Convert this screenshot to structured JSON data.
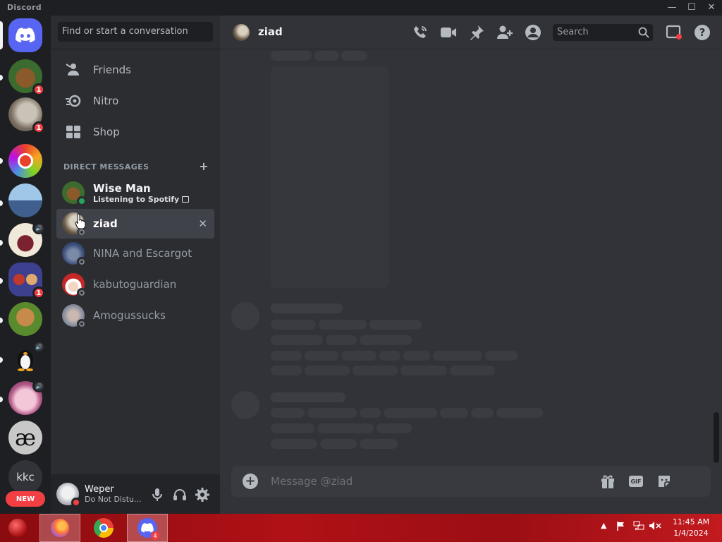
{
  "window": {
    "title": "Discord",
    "minimize": "—",
    "maximize": "☐",
    "close": "✕"
  },
  "rail": {
    "new_label": "NEW",
    "text_server": "kkc",
    "ae_server": "æ",
    "badges": [
      "1",
      "1",
      "1"
    ]
  },
  "sidebar": {
    "search_placeholder": "Find or start a conversation",
    "nav": [
      {
        "label": "Friends",
        "icon": "friends-icon"
      },
      {
        "label": "Nitro",
        "icon": "nitro-icon"
      },
      {
        "label": "Shop",
        "icon": "shop-icon"
      }
    ],
    "dm_header": "DIRECT MESSAGES",
    "dm_add": "+",
    "dms": [
      {
        "name": "Wise Man",
        "sub": "Listening to Spotify",
        "status": "online"
      },
      {
        "name": "ziad",
        "status": "offline",
        "active": true
      },
      {
        "name": "NINA and Escargot",
        "status": "offline"
      },
      {
        "name": "kabutoguardian",
        "status": "offline"
      },
      {
        "name": "Amogussucks",
        "status": "offline"
      }
    ],
    "close_glyph": "✕"
  },
  "user": {
    "name": "Weper",
    "status": "Do Not Distu..."
  },
  "channel": {
    "name": "ziad",
    "search_placeholder": "Search",
    "composer_placeholder": "Message @ziad",
    "gif_label": "GIF"
  },
  "taskbar": {
    "time": "11:45 AM",
    "date": "1/4/2024",
    "discord_badge": "4"
  },
  "colors": {
    "blurple": "#5865f2",
    "online": "#23a55a",
    "dnd": "#f23f43",
    "bg_main": "#313338",
    "bg_sidebar": "#2b2d31"
  }
}
